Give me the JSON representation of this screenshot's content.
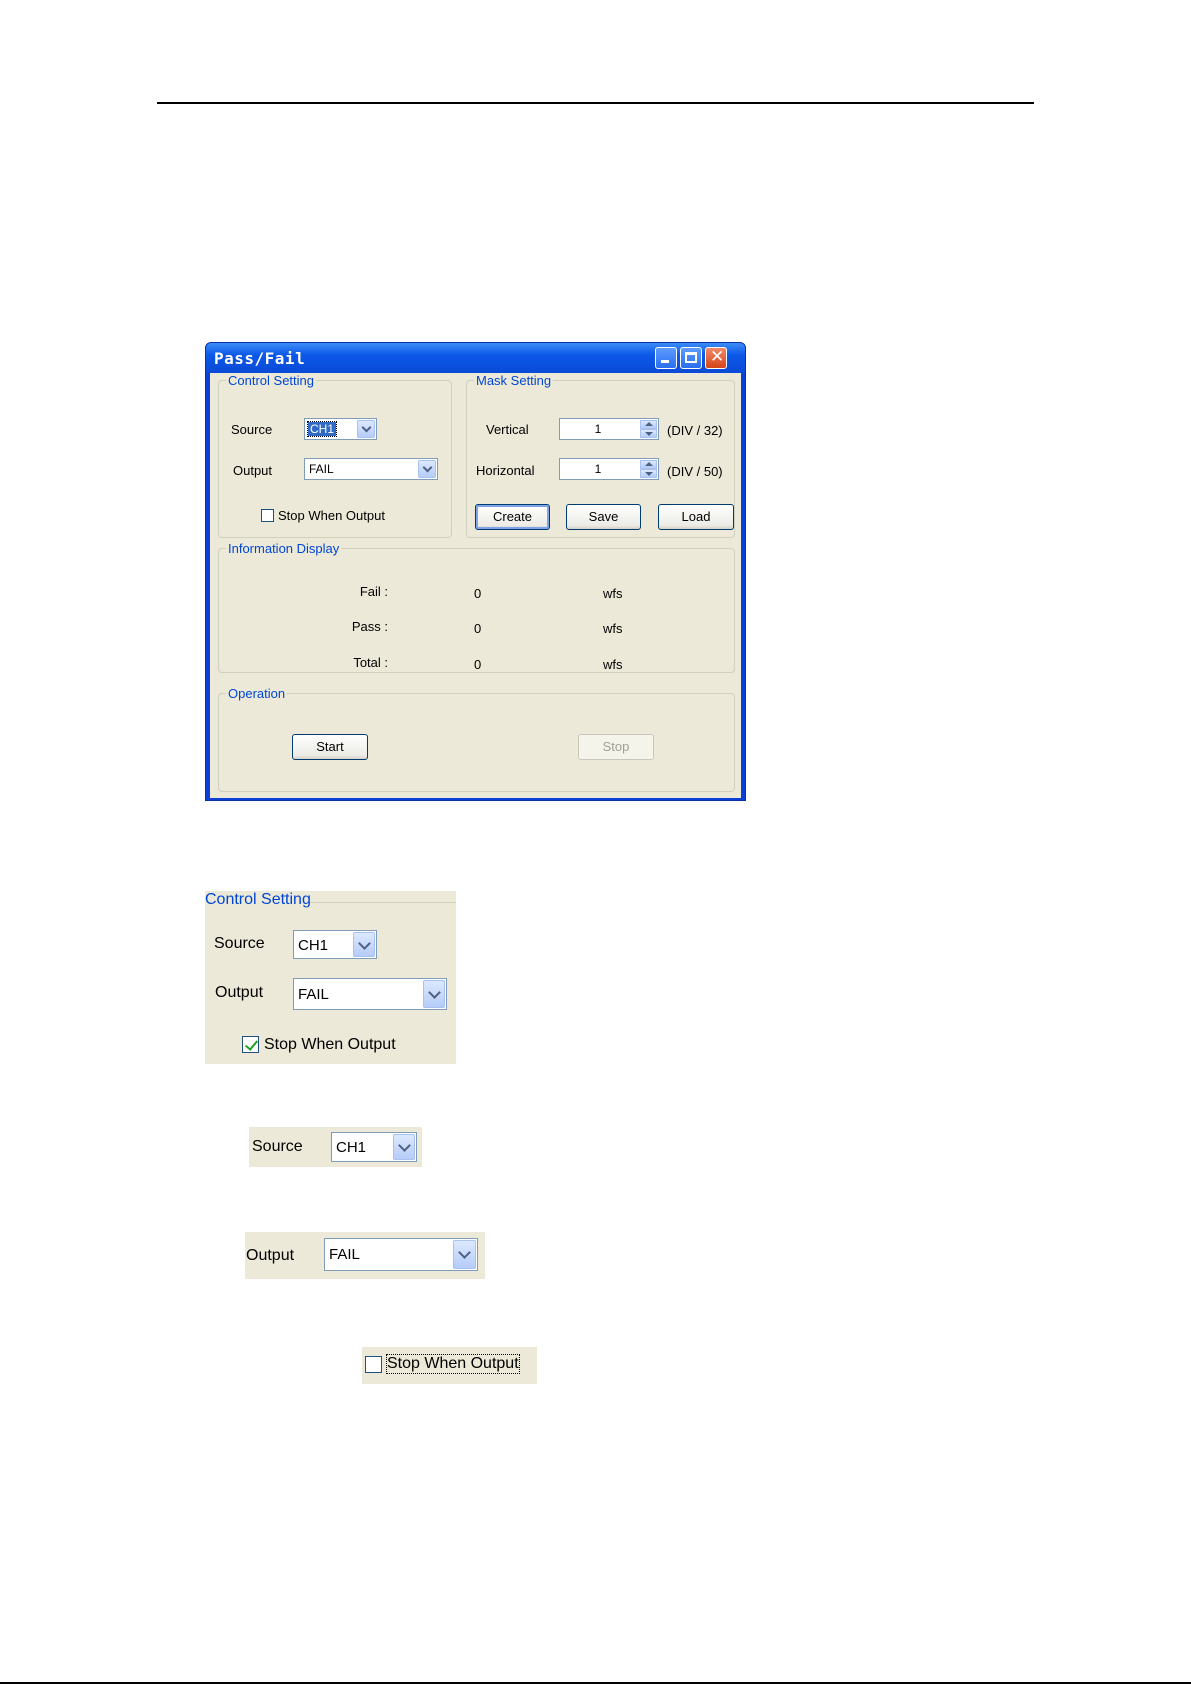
{
  "window": {
    "title": "Pass/Fail",
    "control_setting": {
      "legend": "Control Setting",
      "source_label": "Source",
      "source_value": "CH1",
      "output_label": "Output",
      "output_value": "FAIL",
      "stop_when_output_label": "Stop When Output",
      "stop_when_output_checked": false
    },
    "mask_setting": {
      "legend": "Mask Setting",
      "vertical_label": "Vertical",
      "vertical_value": "1",
      "vertical_unit": "(DIV / 32)",
      "horizontal_label": "Horizontal",
      "horizontal_value": "1",
      "horizontal_unit": "(DIV / 50)",
      "create_label": "Create",
      "save_label": "Save",
      "load_label": "Load"
    },
    "information_display": {
      "legend": "Information Display",
      "rows": [
        {
          "label": "Fail :",
          "value": "0",
          "unit": "wfs"
        },
        {
          "label": "Pass :",
          "value": "0",
          "unit": "wfs"
        },
        {
          "label": "Total :",
          "value": "0",
          "unit": "wfs"
        }
      ]
    },
    "operation": {
      "legend": "Operation",
      "start_label": "Start",
      "stop_label": "Stop"
    }
  },
  "detail_control_setting": {
    "legend": "Control Setting",
    "source_label": "Source",
    "source_value": "CH1",
    "output_label": "Output",
    "output_value": "FAIL",
    "stop_when_output_label": "Stop When Output",
    "stop_when_output_checked": true
  },
  "detail_source": {
    "label": "Source",
    "value": "CH1"
  },
  "detail_output": {
    "label": "Output",
    "value": "FAIL"
  },
  "detail_stop_when_output": {
    "label": "Stop When Output",
    "checked": false
  },
  "icons": [
    "minimize-icon",
    "maximize-icon",
    "close-icon",
    "chevron-down-icon",
    "spin-up-icon",
    "spin-down-icon",
    "checkbox-icon"
  ]
}
